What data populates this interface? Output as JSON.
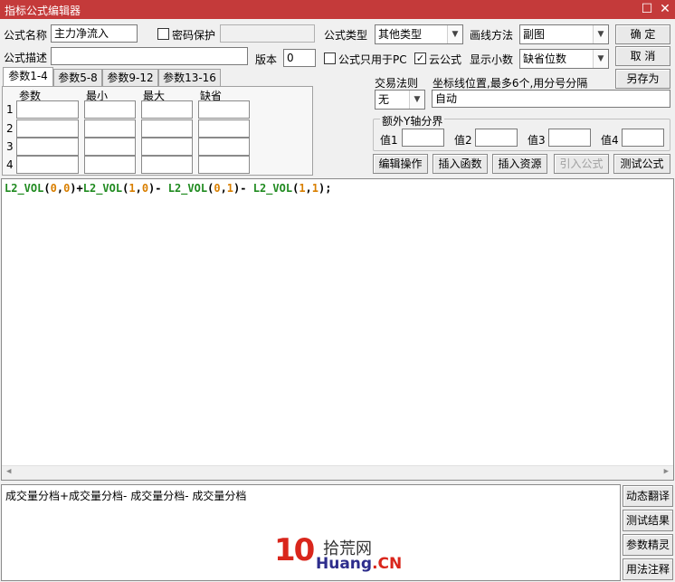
{
  "window": {
    "title": "指标公式编辑器"
  },
  "form": {
    "name_label": "公式名称",
    "name_value": "主力净流入",
    "password_label": "密码保护",
    "password_checked": false,
    "type_label": "公式类型",
    "type_value": "其他类型",
    "draw_label": "画线方法",
    "draw_value": "副图",
    "desc_label": "公式描述",
    "desc_value": "",
    "version_label": "版本",
    "version_value": "0",
    "pc_only_label": "公式只用于PC",
    "pc_only_checked": false,
    "cloud_label": "云公式",
    "cloud_checked": true,
    "decimal_label": "显示小数",
    "decimal_value": "缺省位数"
  },
  "actions": {
    "ok": "确 定",
    "cancel": "取 消",
    "saveas": "另存为"
  },
  "tabs": [
    "参数1-4",
    "参数5-8",
    "参数9-12",
    "参数13-16"
  ],
  "params": {
    "headers": [
      "参数",
      "最小",
      "最大",
      "缺省"
    ],
    "rows": [
      "1",
      "2",
      "3",
      "4"
    ]
  },
  "trade": {
    "label": "交易法则",
    "value": "无"
  },
  "coord": {
    "label": "坐标线位置,最多6个,用分号分隔",
    "value": "自动"
  },
  "yaxis": {
    "label": "额外Y轴分界",
    "v1": "值1",
    "v2": "值2",
    "v3": "值3",
    "v4": "值4"
  },
  "toolbar": {
    "edit": "编辑操作",
    "insert_func": "插入函数",
    "insert_res": "插入资源",
    "import": "引入公式",
    "test": "测试公式"
  },
  "code": {
    "t1": "L2_VOL",
    "t2": "(",
    "t3": "0",
    "t4": ",",
    "t5": "0",
    "t6": ")+",
    "t7": "L2_VOL",
    "t8": "(",
    "t9": "1",
    "t10": ",",
    "t11": "0",
    "t12": ")- ",
    "t13": "L2_VOL",
    "t14": "(",
    "t15": "0",
    "t16": ",",
    "t17": "1",
    "t18": ")- ",
    "t19": "L2_VOL",
    "t20": "(",
    "t21": "1",
    "t22": ",",
    "t23": "1",
    "t24": ");"
  },
  "translation": "成交量分档+成交量分档- 成交量分档- 成交量分档",
  "side": {
    "b1": "动态翻译",
    "b2": "测试结果",
    "b3": "参数精灵",
    "b4": "用法注释"
  },
  "watermark": {
    "num": "10",
    "cn": "拾荒网",
    "en": "Huang",
    "tld": ".CN"
  }
}
